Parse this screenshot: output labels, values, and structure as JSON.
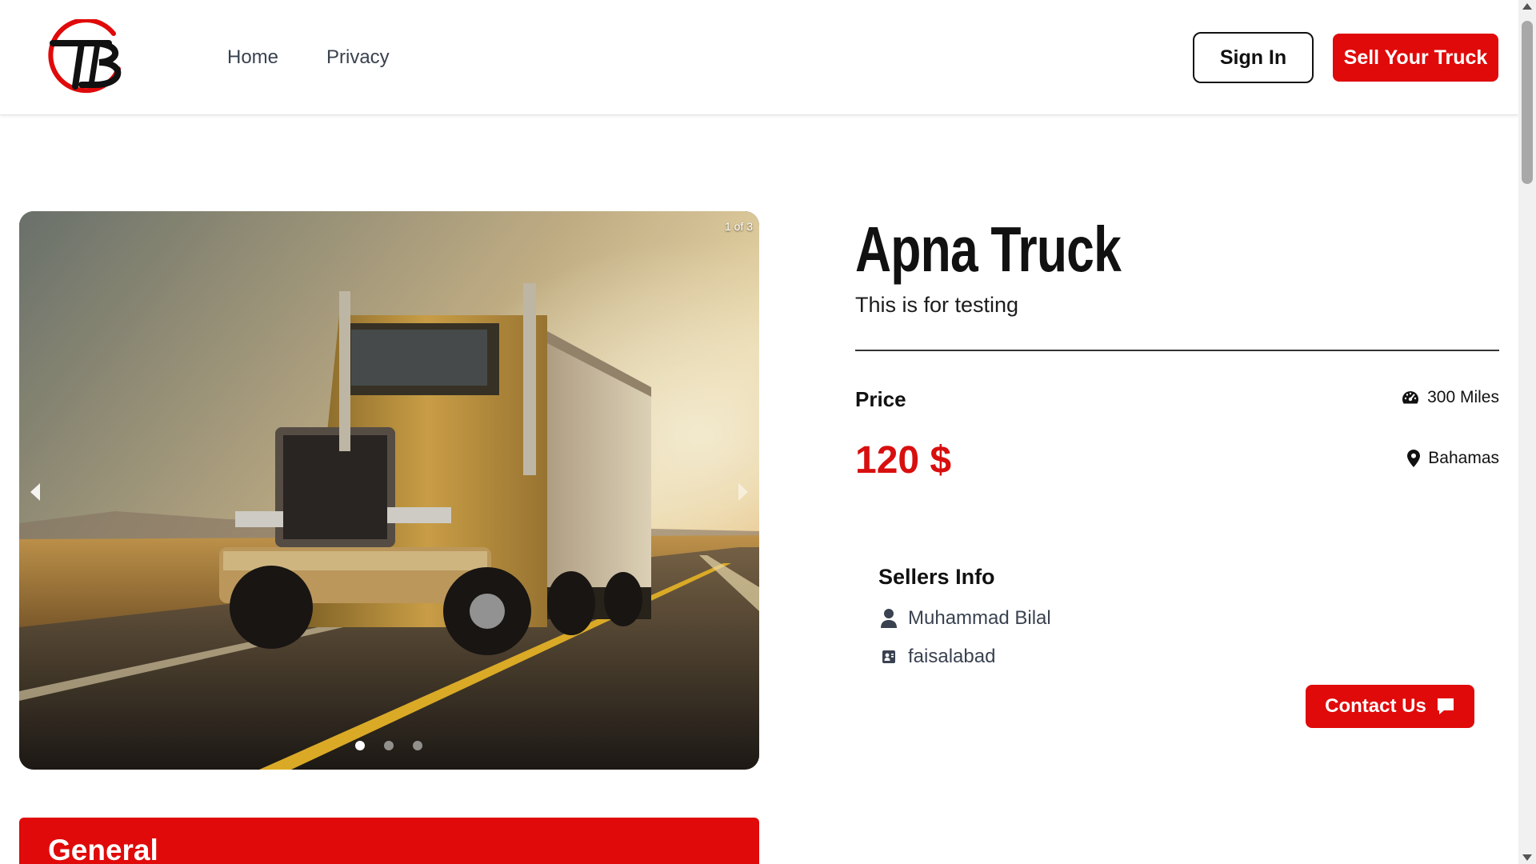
{
  "header": {
    "nav": [
      {
        "label": "Home"
      },
      {
        "label": "Privacy"
      }
    ],
    "sign_in_label": "Sign In",
    "sell_label": "Sell Your Truck",
    "logo_text": "TB"
  },
  "carousel": {
    "counter": "1 of 3",
    "total_slides": 3,
    "active_slide": 1
  },
  "listing": {
    "title": "Apna Truck",
    "description": "This is for testing",
    "price_label": "Price",
    "price": "120 $",
    "mileage": "300 Miles",
    "location": "Bahamas"
  },
  "seller": {
    "heading": "Sellers Info",
    "name": "Muhammad Bilal",
    "city": "faisalabad",
    "contact_label": "Contact Us"
  },
  "general": {
    "heading": "General"
  },
  "colors": {
    "brand_red": "#e00a0a",
    "price_red": "#d80f0f"
  }
}
